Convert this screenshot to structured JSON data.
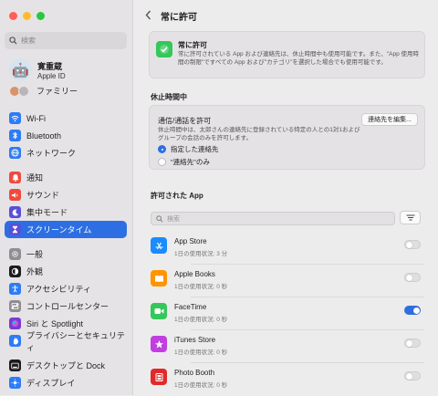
{
  "window": {
    "colors": {
      "close": "#ff5f57",
      "minimize": "#febc2e",
      "zoom": "#28c840",
      "accent": "#2d6fe3"
    }
  },
  "sidebar": {
    "search_placeholder": "検索",
    "user": {
      "name": "寛重蔵",
      "sub": "Apple ID"
    },
    "family_label": "ファミリー",
    "items": [
      {
        "label": "Wi-Fi",
        "icon": "wifi-icon",
        "color": "#2d7cf6"
      },
      {
        "label": "Bluetooth",
        "icon": "bluetooth-icon",
        "color": "#2d7cf6"
      },
      {
        "label": "ネットワーク",
        "icon": "globe-icon",
        "color": "#2d7cf6"
      },
      {
        "label": "通知",
        "icon": "bell-icon",
        "color": "#f04a3e"
      },
      {
        "label": "サウンド",
        "icon": "speaker-icon",
        "color": "#f04a3e"
      },
      {
        "label": "集中モード",
        "icon": "moon-icon",
        "color": "#5a4fd8"
      },
      {
        "label": "スクリーンタイム",
        "icon": "hourglass-icon",
        "color": "#5a4fd8"
      },
      {
        "label": "一般",
        "icon": "gear-icon",
        "color": "#8e8e93"
      },
      {
        "label": "外観",
        "icon": "appearance-icon",
        "color": "#1c1c1e"
      },
      {
        "label": "アクセシビリティ",
        "icon": "accessibility-icon",
        "color": "#2d7cf6"
      },
      {
        "label": "コントロールセンター",
        "icon": "control-center-icon",
        "color": "#8e8e93"
      },
      {
        "label": "Siri と Spotlight",
        "icon": "siri-icon",
        "color": "#7a3ccf"
      },
      {
        "label": "プライバシーとセキュリティ",
        "icon": "hand-icon",
        "color": "#2d7cf6"
      },
      {
        "label": "デスクトップと Dock",
        "icon": "dock-icon",
        "color": "#1c1c1e"
      },
      {
        "label": "ディスプレイ",
        "icon": "sun-icon",
        "color": "#2d7cf6"
      }
    ]
  },
  "main": {
    "title": "常に許可",
    "info": {
      "title": "常に許可",
      "desc": "常に許可されている App および連絡先は、休止時間中も使用可能です。また、\"App 使用時間の制限\"ですべての App および\"カテゴリ\"を選択した場合でも使用可能です。"
    },
    "downtime": {
      "section": "休止時間中",
      "title": "通信/通話を許可",
      "desc": "休止時間中は、太郎さんの連絡先に登録されている特定の人との1対1およびグループの会話のみを許可します。",
      "edit_button": "連絡先を編集...",
      "options": [
        {
          "label": "指定した連絡先",
          "selected": true
        },
        {
          "label": "\"連絡先\"のみ",
          "selected": false
        }
      ]
    },
    "apps": {
      "section": "許可された App",
      "search_placeholder": "検索",
      "list": [
        {
          "name": "App Store",
          "usage": "1日の使用状況: 3 分",
          "enabled": false,
          "icon": "app-store-icon",
          "color": "#1a8cff"
        },
        {
          "name": "Apple Books",
          "usage": "1日の使用状況: 0 秒",
          "enabled": false,
          "icon": "books-icon",
          "color": "#ff9500"
        },
        {
          "name": "FaceTime",
          "usage": "1日の使用状況: 0 秒",
          "enabled": true,
          "icon": "facetime-icon",
          "color": "#34c759"
        },
        {
          "name": "iTunes Store",
          "usage": "1日の使用状況: 0 秒",
          "enabled": false,
          "icon": "itunes-icon",
          "color": "#c13ee0"
        },
        {
          "name": "Photo Booth",
          "usage": "1日の使用状況: 0 秒",
          "enabled": false,
          "icon": "photo-booth-icon",
          "color": "#e02a2a"
        }
      ]
    }
  }
}
